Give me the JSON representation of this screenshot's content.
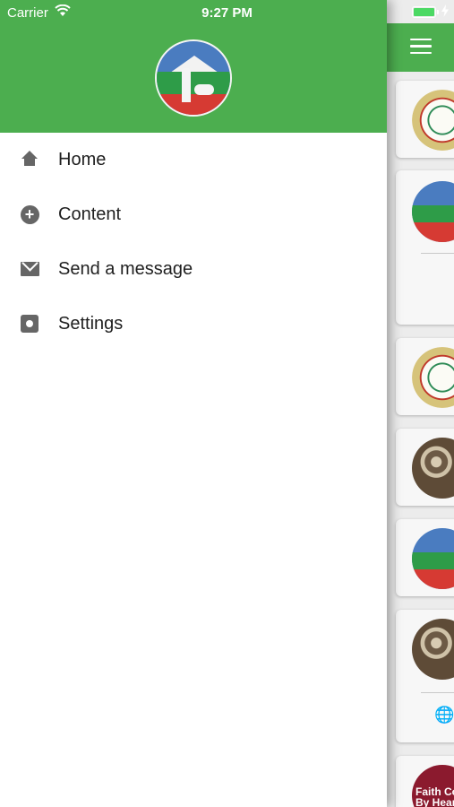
{
  "status_bar": {
    "carrier": "Carrier",
    "time": "9:27 PM",
    "battery_color": "#4cd964"
  },
  "colors": {
    "accent_green": "#4cae4f",
    "drawer_bg": "#ffffff",
    "icon_gray": "#666666"
  },
  "drawer": {
    "menu": [
      {
        "label": "Home",
        "icon": "home-icon"
      },
      {
        "label": "Content",
        "icon": "plus-circle-icon"
      },
      {
        "label": "Send a message",
        "icon": "mail-icon"
      },
      {
        "label": "Settings",
        "icon": "gear-icon"
      }
    ]
  },
  "background_list": {
    "cards": [
      {
        "thumb": "mosaic"
      },
      {
        "thumb": "logo",
        "has_divider": true
      },
      {
        "thumb": "mosaic"
      },
      {
        "thumb": "calligraphy"
      },
      {
        "thumb": "logo"
      },
      {
        "thumb": "calligraphy",
        "has_divider": true,
        "action_icon": "globe-icon"
      },
      {
        "thumb": "faith",
        "thumb_text": "Faith Co\nBy Hearin"
      }
    ]
  }
}
